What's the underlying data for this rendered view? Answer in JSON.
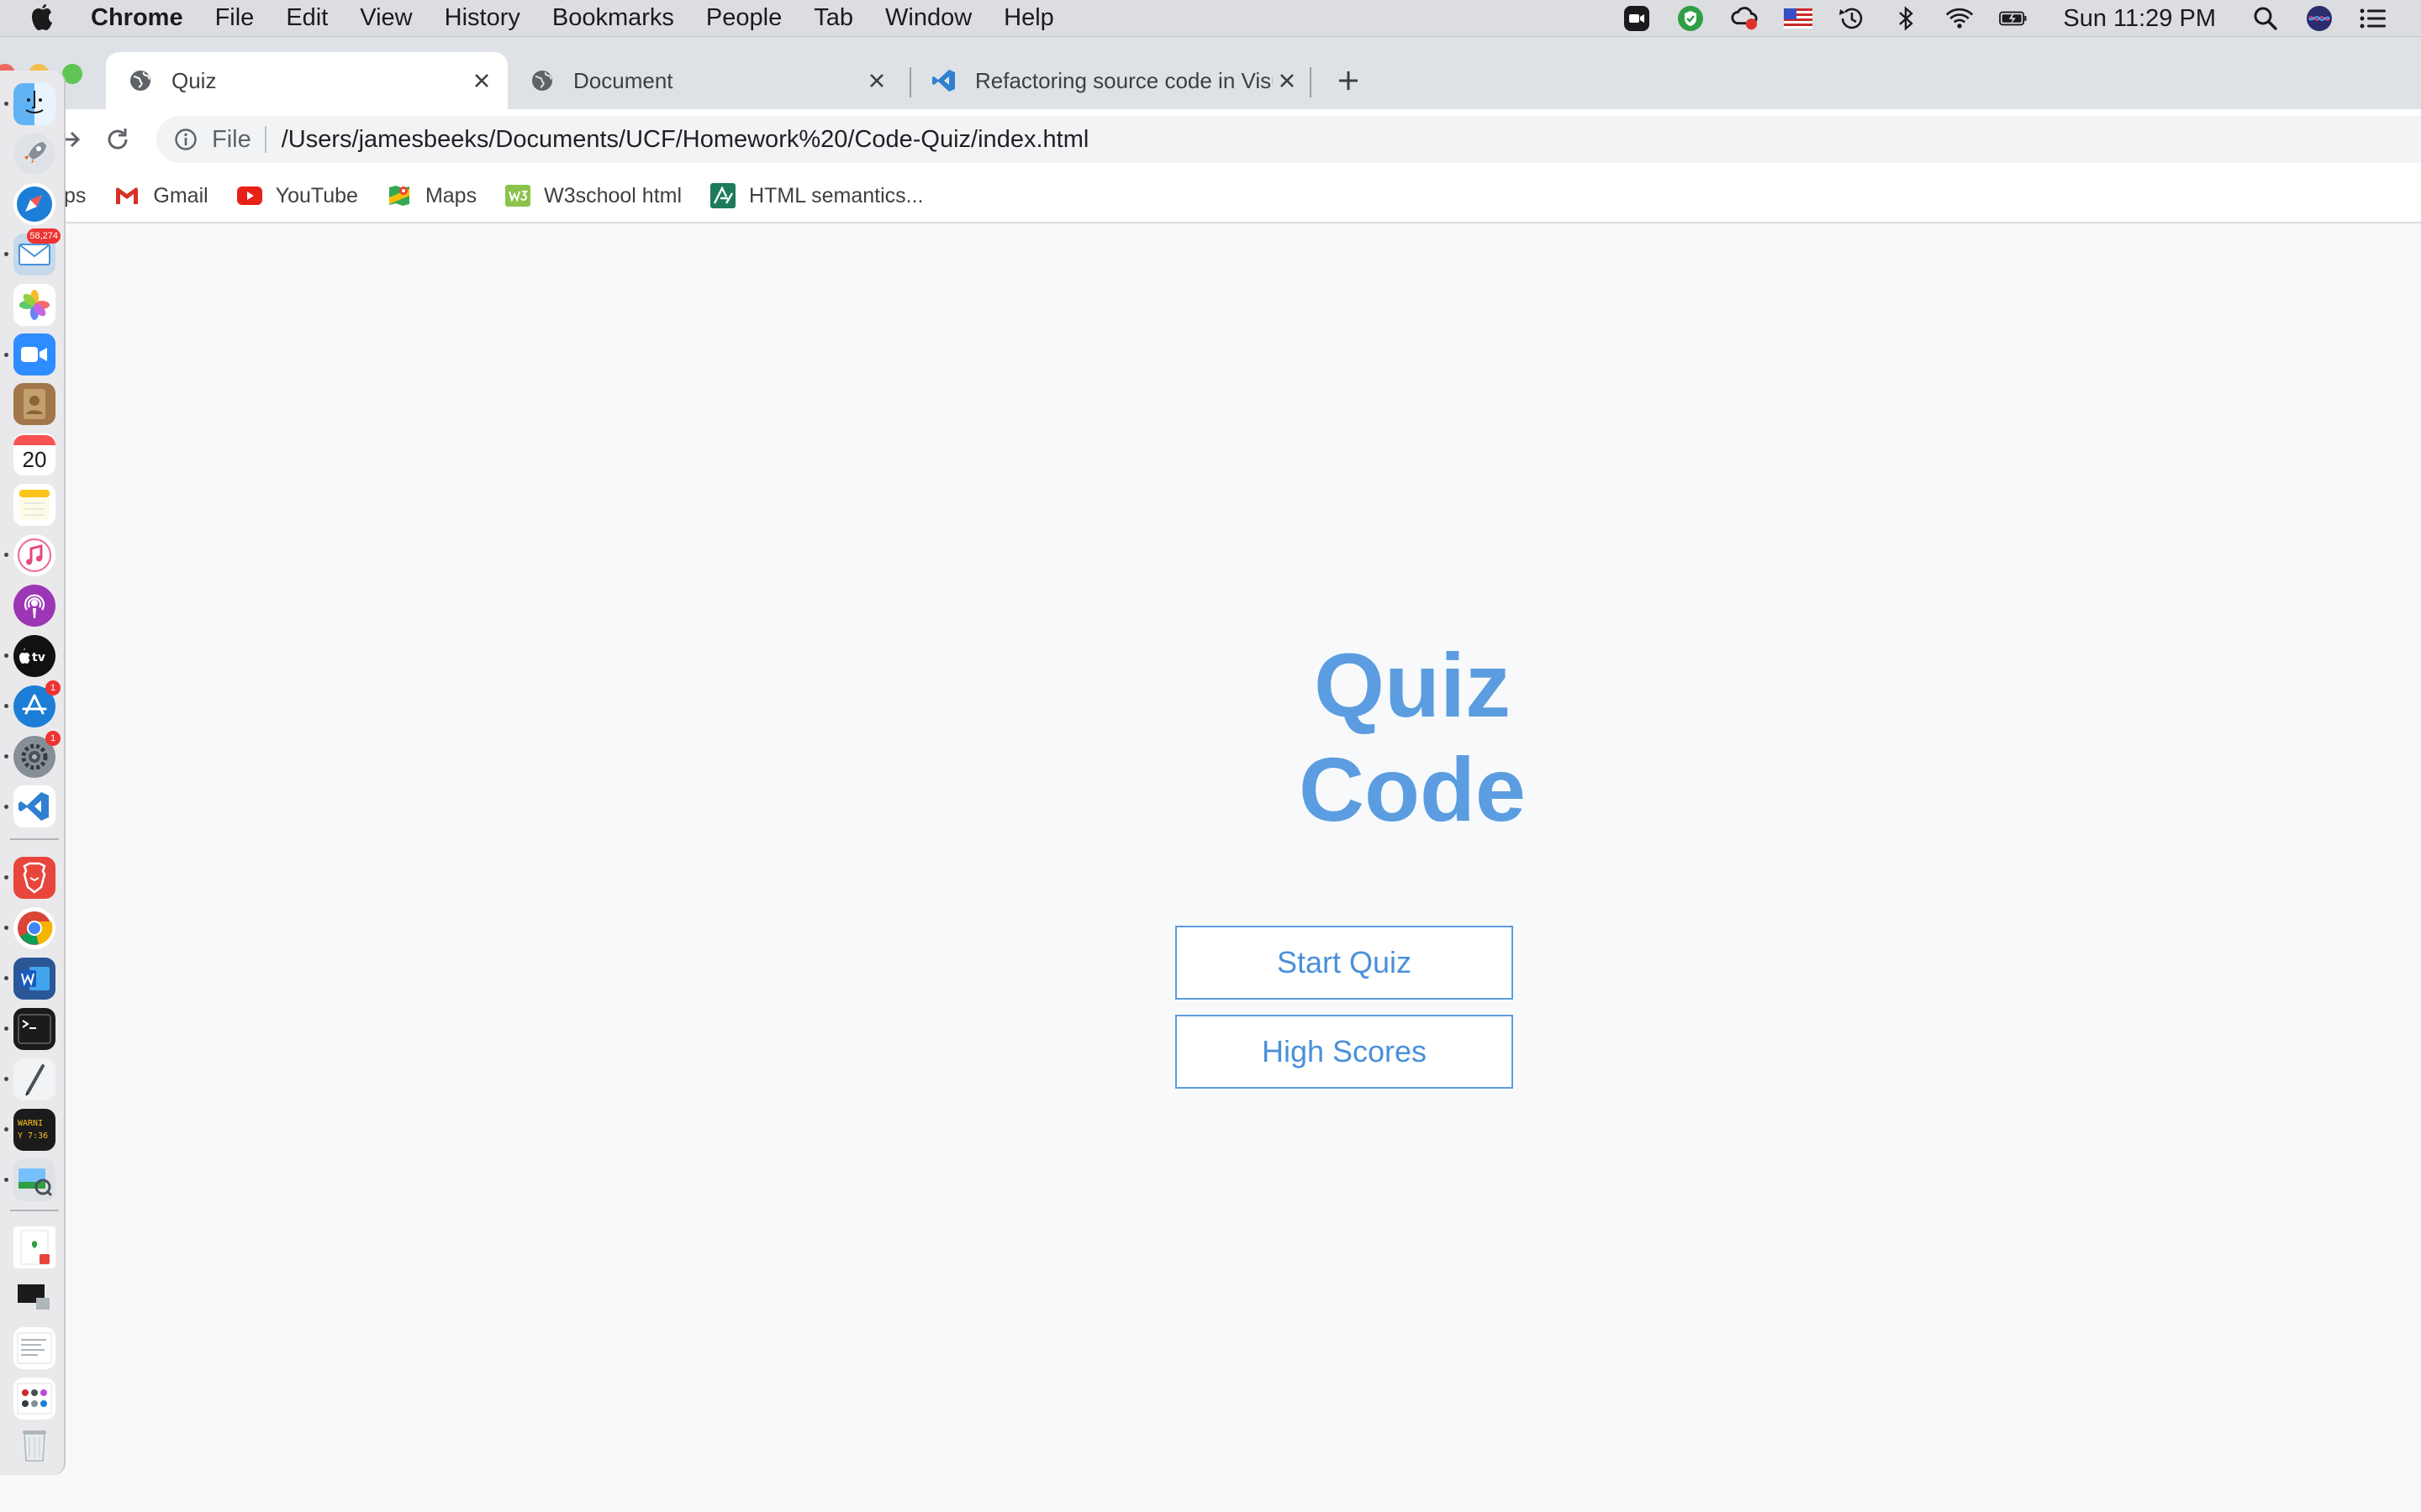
{
  "menubar": {
    "app_name": "Chrome",
    "items": [
      "File",
      "Edit",
      "View",
      "History",
      "Bookmarks",
      "People",
      "Tab",
      "Window",
      "Help"
    ],
    "clock": "Sun 11:29 PM"
  },
  "tabs": [
    {
      "title": "Quiz",
      "icon": "globe-icon",
      "active": true
    },
    {
      "title": "Document",
      "icon": "globe-icon",
      "active": false
    },
    {
      "title": "Refactoring source code in Visu",
      "icon": "vscode-icon",
      "active": false
    }
  ],
  "omnibox": {
    "scheme_label": "File",
    "url": "/Users/jamesbeeks/Documents/UCF/Homework%20/Code-Quiz/index.html"
  },
  "bookmarks": [
    {
      "label": "ps",
      "icon": "apps-icon"
    },
    {
      "label": "Gmail",
      "icon": "gmail-icon"
    },
    {
      "label": "YouTube",
      "icon": "youtube-icon"
    },
    {
      "label": "Maps",
      "icon": "maps-icon"
    },
    {
      "label": "W3school html",
      "icon": "w3schools-icon"
    },
    {
      "label": "HTML semantics...",
      "icon": "bookmark-site-icon"
    }
  ],
  "dock": {
    "mail_badge": "58,274",
    "appstore_badge": "1",
    "prefs_badge": "1",
    "calendar_day": "20"
  },
  "page": {
    "title_line1": "Quiz",
    "title_line2": "Code",
    "start_button": "Start Quiz",
    "scores_button": "High Scores"
  },
  "colors": {
    "accent": "#5b9de0",
    "page_bg": "#f7f9fa"
  }
}
